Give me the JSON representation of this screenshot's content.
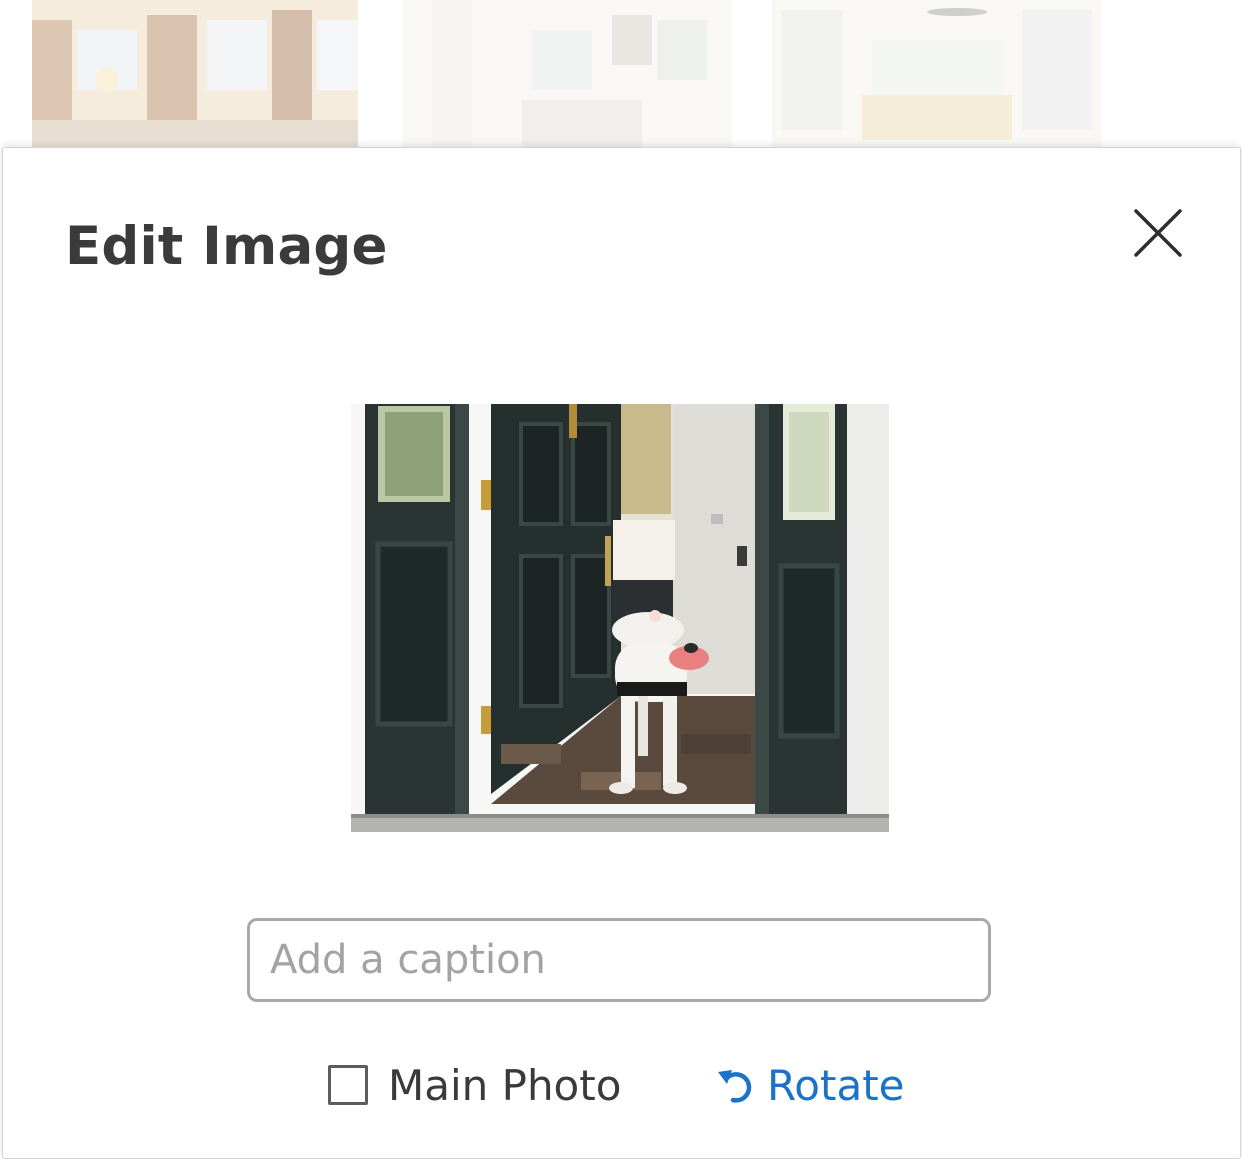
{
  "modal": {
    "title": "Edit Image",
    "close_icon": "close-icon",
    "caption": {
      "placeholder": "Add a caption",
      "value": ""
    },
    "main_photo": {
      "label": "Main Photo",
      "checked": false
    },
    "rotate": {
      "icon": "rotate-left-icon",
      "label": "Rotate"
    }
  },
  "colors": {
    "title_text": "#3b3b3b",
    "link_blue": "#1a73c9",
    "input_border": "#a9a9a9"
  }
}
